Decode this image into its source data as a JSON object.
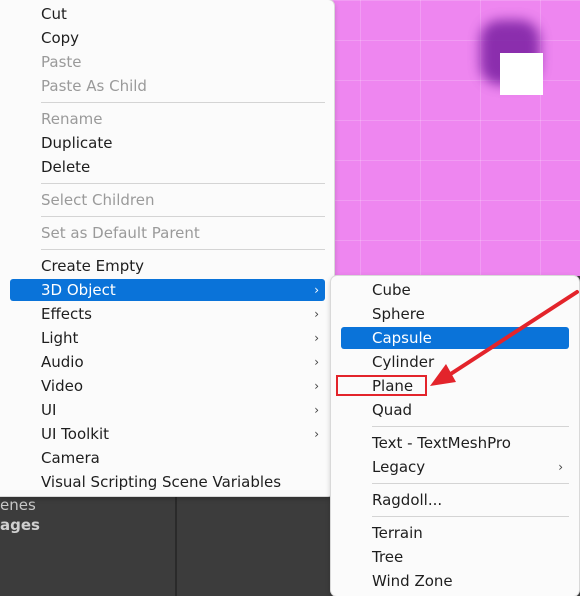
{
  "scene": {
    "colors": {
      "background": "#ee86f0",
      "shadow": "#7a1fa2",
      "square": "#ffffff"
    },
    "lower_panel": {
      "text_line1": "enes",
      "text_line2": "ages"
    }
  },
  "context_menu": {
    "items": [
      {
        "label": "Cut"
      },
      {
        "label": "Copy"
      },
      {
        "label": "Paste",
        "disabled": true
      },
      {
        "label": "Paste As Child",
        "disabled": true
      },
      {
        "label": "Rename",
        "disabled": true
      },
      {
        "label": "Duplicate"
      },
      {
        "label": "Delete"
      },
      {
        "label": "Select Children",
        "disabled": true
      },
      {
        "label": "Set as Default Parent",
        "disabled": true
      },
      {
        "label": "Create Empty"
      },
      {
        "label": "3D Object",
        "selected": true,
        "submenu": true
      },
      {
        "label": "Effects",
        "submenu": true
      },
      {
        "label": "Light",
        "submenu": true
      },
      {
        "label": "Audio",
        "submenu": true
      },
      {
        "label": "Video",
        "submenu": true
      },
      {
        "label": "UI",
        "submenu": true
      },
      {
        "label": "UI Toolkit",
        "submenu": true
      },
      {
        "label": "Camera"
      },
      {
        "label": "Visual Scripting Scene Variables"
      }
    ],
    "submenu_arrow": "›"
  },
  "submenu_3d_object": {
    "items": [
      {
        "label": "Cube"
      },
      {
        "label": "Sphere"
      },
      {
        "label": "Capsule",
        "selected": true
      },
      {
        "label": "Cylinder"
      },
      {
        "label": "Plane",
        "annotated": true
      },
      {
        "label": "Quad"
      },
      {
        "label": "Text - TextMeshPro"
      },
      {
        "label": "Legacy",
        "submenu": true
      },
      {
        "label": "Ragdoll..."
      },
      {
        "label": "Terrain"
      },
      {
        "label": "Tree"
      },
      {
        "label": "Wind Zone"
      }
    ]
  },
  "annotation": {
    "color": "#e3242b",
    "target": "Plane"
  },
  "accent_color": "#0a73d9"
}
